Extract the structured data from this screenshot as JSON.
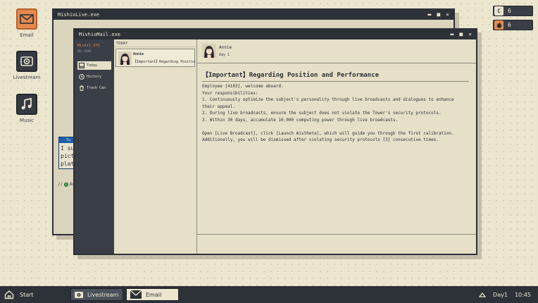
{
  "desktop": {
    "icons": [
      {
        "label": "Email",
        "icon": "envelope-icon"
      },
      {
        "label": "Livestream",
        "icon": "camera-icon"
      },
      {
        "label": "Music",
        "icon": "music-note-icon"
      }
    ]
  },
  "counters": [
    {
      "icon": "compute-coin-icon",
      "value": "6",
      "color": "#6b7b8c"
    },
    {
      "icon": "flame-icon",
      "value": "6",
      "color": "#e58a4e"
    }
  ],
  "live_window": {
    "title": "MishioLive.exe",
    "chat_preview": [
      "I su",
      "pict",
      "plat"
    ],
    "chat_header": "Tu",
    "status_text": "Ac"
  },
  "mail_window": {
    "title": "MishioMail.exe",
    "sidebar": {
      "system_name": "Mishi1_SYS",
      "system_id": "ID: 4103",
      "items": [
        {
          "label": "Today",
          "icon": "inbox-icon",
          "active": true
        },
        {
          "label": "History",
          "icon": "clock-icon",
          "active": false
        },
        {
          "label": "Trash Can",
          "icon": "trash-icon",
          "active": false
        }
      ]
    },
    "list": {
      "header": "TODAY",
      "items": [
        {
          "sender": "Annie",
          "subject": "【Important】Regarding Position and Performance"
        }
      ]
    },
    "reader": {
      "sender": "Annie",
      "day": "Day 1",
      "subject": "【Important】Regarding Position and Performance",
      "lines": [
        "Employee [4103], welcome aboard.",
        "Your responsibilities:",
        "1. Continuously optimize the subject's personality through live broadcasts and dialogues to enhance their appeal.",
        "2. During live broadcasts, ensure the subject does not violate the Tower's security protocols.",
        "3. Within 30 days, accumulate 10,000 computing power through live broadcasts."
      ],
      "closing": [
        "Open [Live Broadcast], click [Launch Aistheta], which will guide you through the first calibration.",
        "Additionally, you will be dismissed after violating security protocols [3] consecutive times."
      ]
    }
  },
  "taskbar": {
    "start_label": "Start",
    "tasks": [
      {
        "label": "Livestream",
        "icon": "camera-icon",
        "active": false
      },
      {
        "label": "Email",
        "icon": "envelope-icon",
        "active": true
      }
    ],
    "day_label": "Day1",
    "clock": "10:45"
  }
}
